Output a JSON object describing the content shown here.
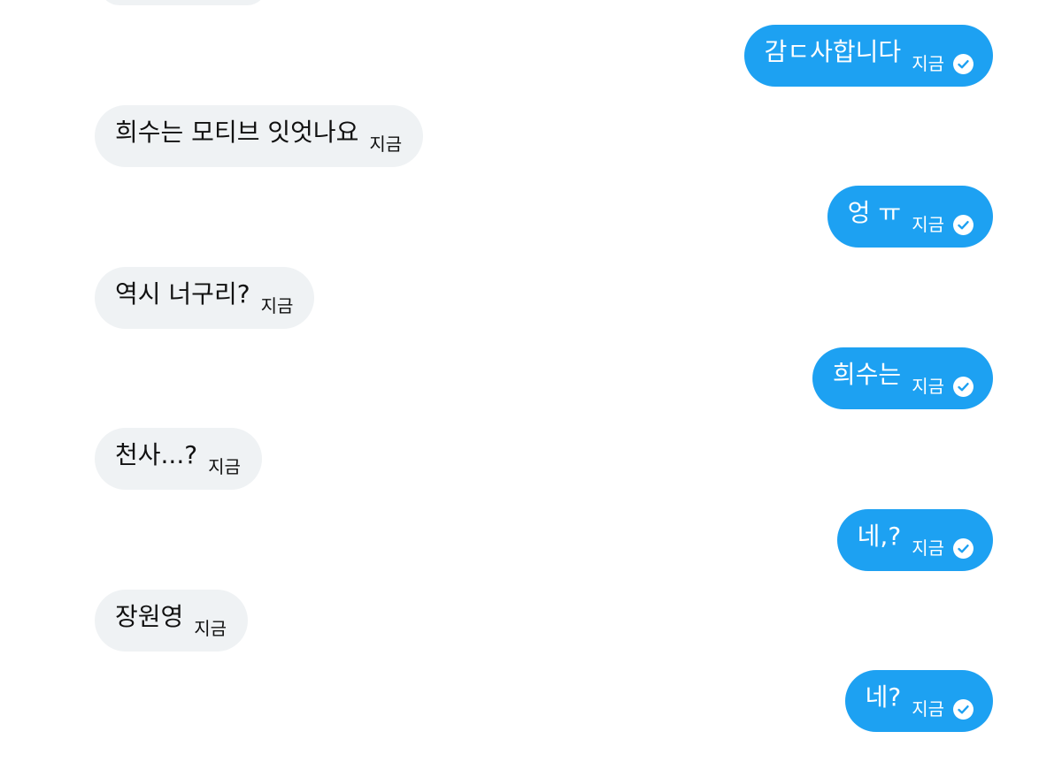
{
  "messages": [
    {
      "dir": "out",
      "text": "감ㄷ사합니다",
      "time": "지금",
      "status_icon": "check-circle-icon"
    },
    {
      "dir": "in",
      "text": "희수는 모티브 잇엇나요",
      "time": "지금"
    },
    {
      "dir": "out",
      "text": "엉 ㅠ",
      "time": "지금",
      "status_icon": "check-circle-icon"
    },
    {
      "dir": "in",
      "text": "역시 너구리?",
      "time": "지금"
    },
    {
      "dir": "out",
      "text": "희수는",
      "time": "지금",
      "status_icon": "check-circle-icon"
    },
    {
      "dir": "in",
      "text": "천사...?",
      "time": "지금"
    },
    {
      "dir": "out",
      "text": "네,?",
      "time": "지금",
      "status_icon": "check-circle-icon"
    },
    {
      "dir": "in",
      "text": "장원영",
      "time": "지금"
    },
    {
      "dir": "out",
      "text": "네?",
      "time": "지금",
      "status_icon": "check-circle-icon"
    }
  ],
  "colors": {
    "outgoing_bubble": "#1da1f2",
    "incoming_bubble": "#eff2f4",
    "incoming_text": "#111111",
    "outgoing_text": "#ffffff"
  }
}
